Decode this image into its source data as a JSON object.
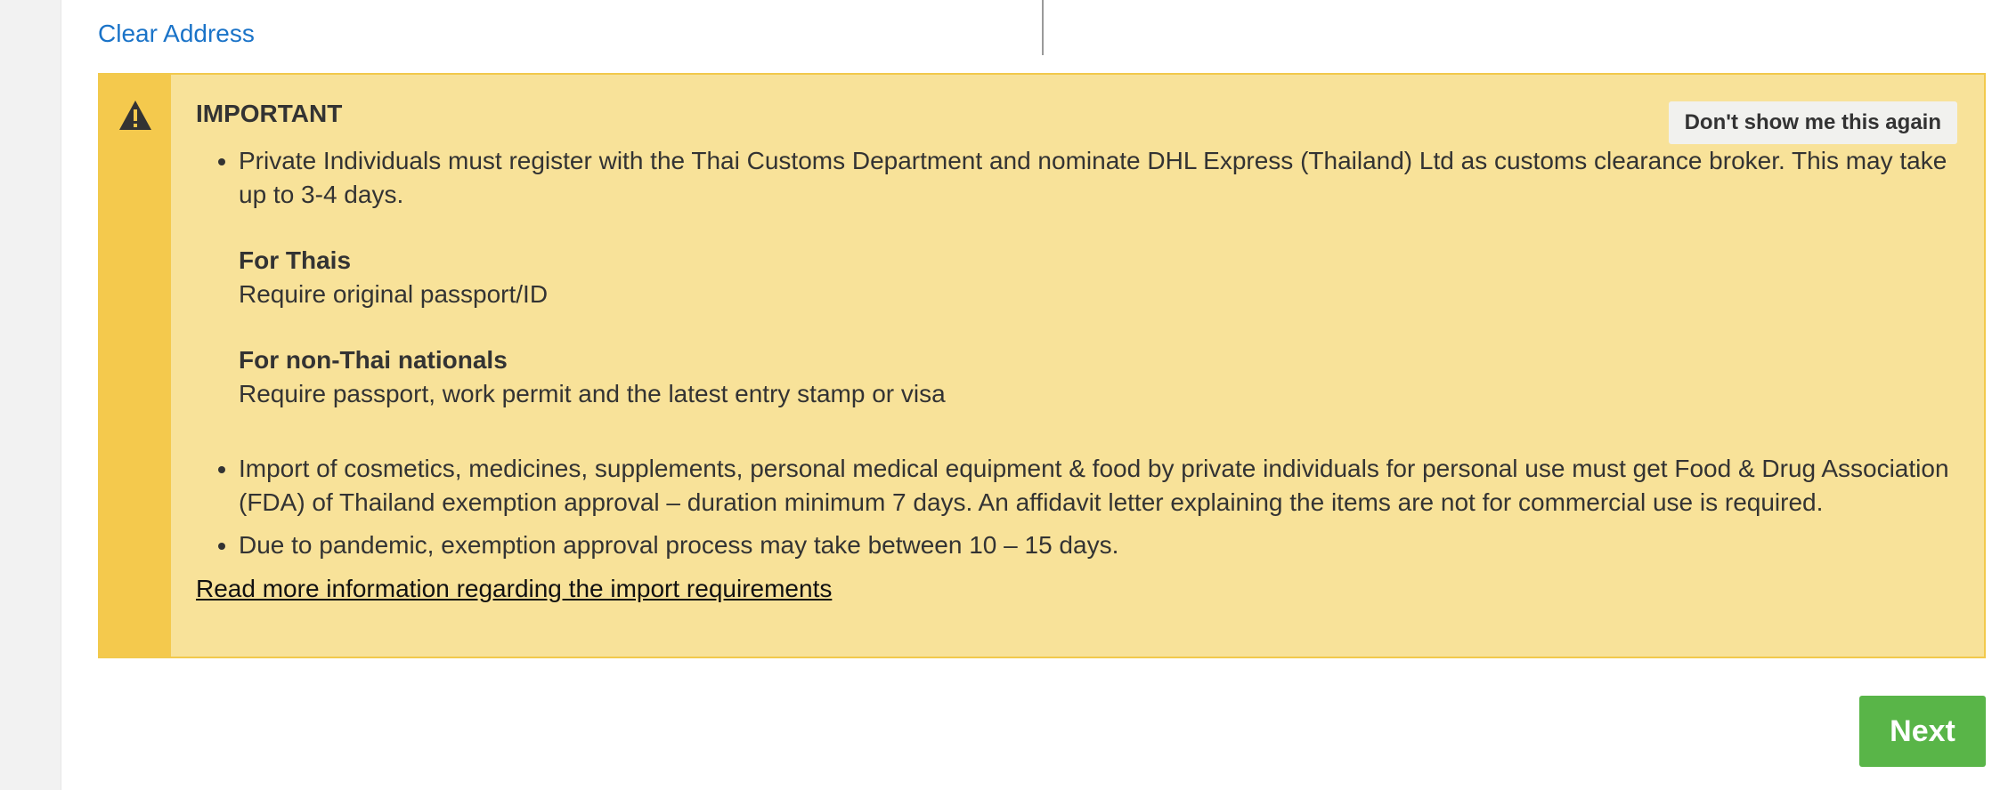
{
  "address": {
    "clear_label": "Clear Address"
  },
  "notice": {
    "icon": "warning-icon",
    "title": "IMPORTANT",
    "dismiss_label": "Don't show me this again",
    "bullets": {
      "b1": "Private Individuals must register with the Thai Customs Department and nominate DHL Express (Thailand) Ltd as customs clearance broker. This may take up to 3-4 days.",
      "thais_heading": "For Thais",
      "thais_text": "Require original passport/ID",
      "nonthai_heading": "For non-Thai nationals",
      "nonthai_text": "Require passport, work permit and the latest entry stamp or visa",
      "b2": "Import of cosmetics, medicines, supplements, personal medical equipment & food by private individuals for personal use must get Food & Drug Association (FDA) of Thailand exemption approval – duration minimum 7 days. An affidavit letter explaining the items are not for commercial use is required.",
      "b3": "Due to pandemic, exemption approval process may take between 10 – 15 days."
    },
    "read_more_label": "Read more information regarding the import requirements"
  },
  "actions": {
    "next_label": "Next"
  },
  "colors": {
    "link": "#1a73c8",
    "notice_bg": "#f8e299",
    "notice_stripe": "#f4c94d",
    "next_bg": "#59b548"
  }
}
